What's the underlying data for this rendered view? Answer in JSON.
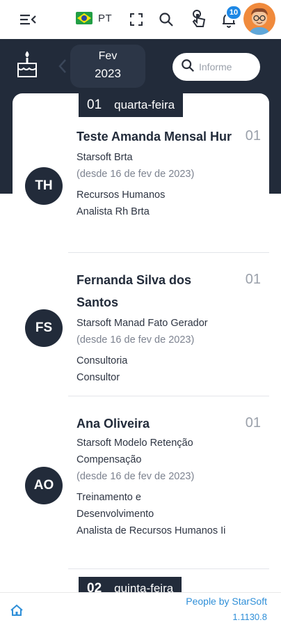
{
  "topbar": {
    "language": "PT",
    "notifications_count": "10",
    "icons": [
      "menu-collapse-icon",
      "brazil-flag-icon",
      "fullscreen-icon",
      "search-icon",
      "touch-icon",
      "bell-icon",
      "user-avatar"
    ]
  },
  "header": {
    "icon": "birthday-cake-icon",
    "month": "Fev",
    "year": "2023",
    "search_placeholder": "Informe"
  },
  "days": [
    {
      "day": "01",
      "weekday": "quarta-feira"
    },
    {
      "day": "02",
      "weekday": "quinta-feira"
    }
  ],
  "people": [
    {
      "initials": "TH",
      "name": "Teste Amanda Mensal Hur",
      "day": "01",
      "company": "Starsoft Brta",
      "since": "(desde 16 de fev de 2023)",
      "department": "Recursos Humanos",
      "role": "Analista Rh Brta"
    },
    {
      "initials": "FS",
      "name": "Fernanda Silva dos Santos",
      "day": "01",
      "company": "Starsoft Manad Fato Gerador",
      "since": "(desde 16 de fev de 2023)",
      "department": "Consultoria",
      "role": "Consultor"
    },
    {
      "initials": "AO",
      "name": "Ana Oliveira",
      "day": "01",
      "company": "Starsoft Modelo Retenção Compensação",
      "since": "(desde 16 de fev de 2023)",
      "department": "Treinamento e Desenvolvimento",
      "role": "Analista de Recursos Humanos Ii"
    }
  ],
  "footer": {
    "brand": "People by StarSoft",
    "version": "1.1130.8"
  },
  "colors": {
    "dark": "#222b3a",
    "accent": "#2f8fd8",
    "badge": "#1e88e5"
  }
}
